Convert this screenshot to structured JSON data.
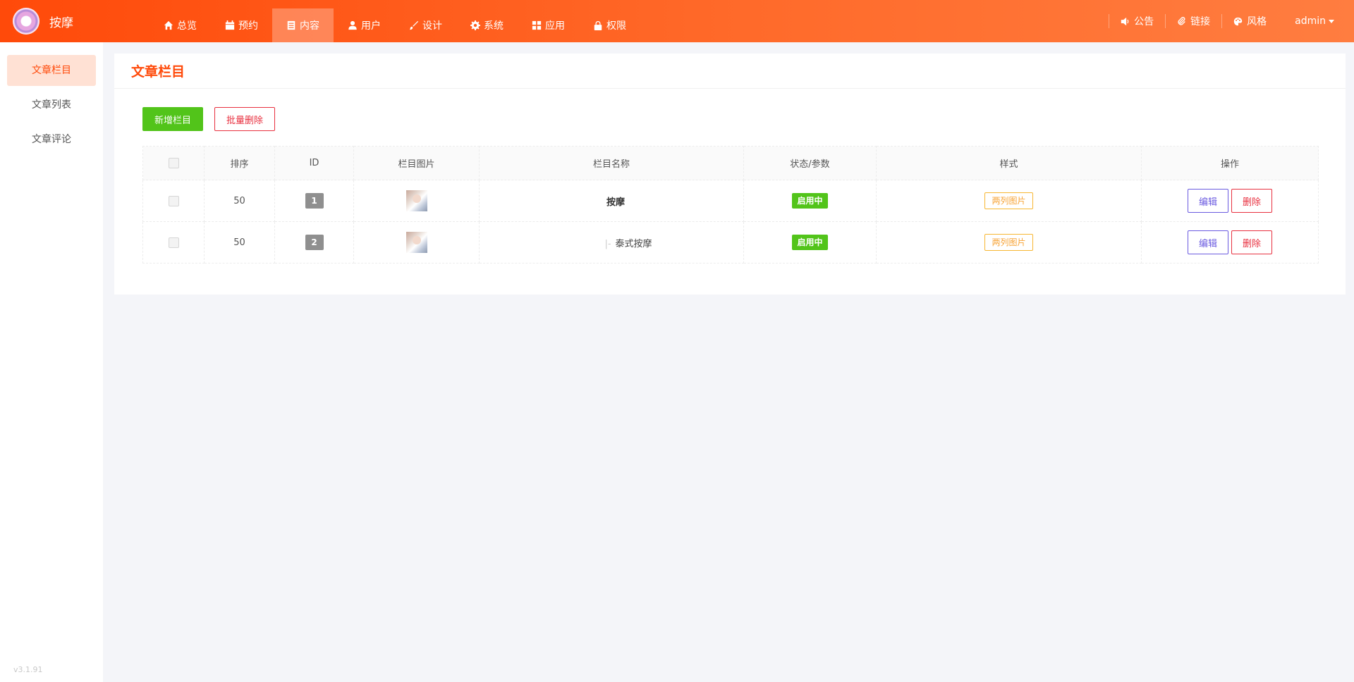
{
  "app": {
    "brand": "按摩"
  },
  "nav": [
    {
      "label": "总览",
      "icon": "home-icon"
    },
    {
      "label": "预约",
      "icon": "calendar-icon"
    },
    {
      "label": "内容",
      "icon": "document-icon",
      "active": true
    },
    {
      "label": "用户",
      "icon": "user-icon"
    },
    {
      "label": "设计",
      "icon": "brush-icon"
    },
    {
      "label": "系统",
      "icon": "gear-icon"
    },
    {
      "label": "应用",
      "icon": "grid-icon"
    },
    {
      "label": "权限",
      "icon": "lock-icon"
    }
  ],
  "right_nav": {
    "notice": "公告",
    "links": "链接",
    "theme": "风格",
    "user": "admin"
  },
  "sidebar": {
    "items": [
      "文章栏目",
      "文章列表",
      "文章评论"
    ],
    "active": 0,
    "version": "v3.1.91"
  },
  "page": {
    "title": "文章栏目",
    "add_button": "新增栏目",
    "batch_delete_button": "批量删除"
  },
  "table": {
    "headers": [
      "排序",
      "ID",
      "栏目图片",
      "栏目名称",
      "状态/参数",
      "样式",
      "操作"
    ],
    "rows": [
      {
        "sort": "50",
        "id": "1",
        "name": "按摩",
        "level": 0,
        "status": "启用中",
        "style": "两列图片",
        "edit": "编辑",
        "delete": "删除"
      },
      {
        "sort": "50",
        "id": "2",
        "name": "泰式按摩",
        "level": 1,
        "tree_prefix": "|-",
        "status": "启用中",
        "style": "两列图片",
        "edit": "编辑",
        "delete": "删除"
      }
    ]
  },
  "colors": {
    "brand": "#ff4a0a",
    "success": "#52c41a",
    "danger": "#e8303f",
    "warning": "#f7a233",
    "edit": "#6a5ae0"
  }
}
